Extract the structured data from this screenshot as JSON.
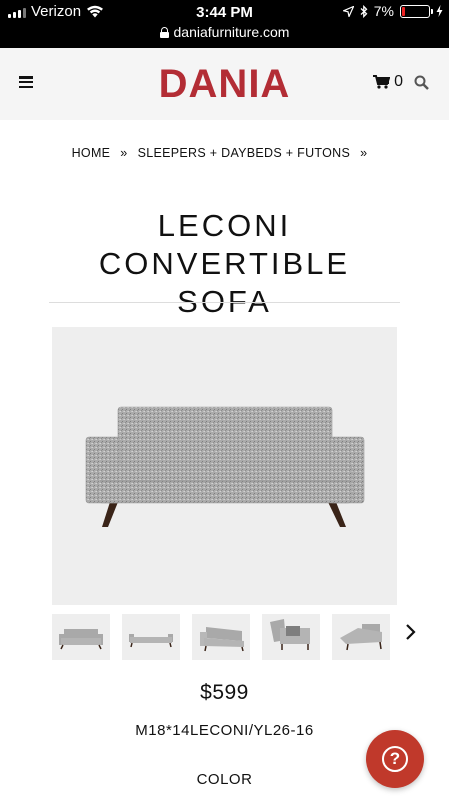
{
  "status_bar": {
    "carrier": "Verizon",
    "time": "3:44 PM",
    "battery": "7%",
    "url": "daniafurniture.com"
  },
  "header": {
    "logo": "DANIA",
    "cart_count": "0",
    "icons": [
      "menu-icon",
      "cart-icon",
      "search-icon"
    ],
    "brand_color": "#b32d35"
  },
  "breadcrumb": {
    "home": "HOME",
    "separator": "»",
    "category": "SLEEPERS + DAYBEDS + FUTONS",
    "trailing_separator": "»"
  },
  "product": {
    "title_line1": "LECONI CONVERTIBLE",
    "title_line2": "SOFA",
    "price": "$599",
    "sku": "M18*14LECONI/YL26-16",
    "color_label": "COLOR",
    "fabric_color": "#a9a9a9",
    "thumbnail_count": 5
  },
  "help_button": {
    "symbol": "?",
    "color": "#c0392b"
  }
}
